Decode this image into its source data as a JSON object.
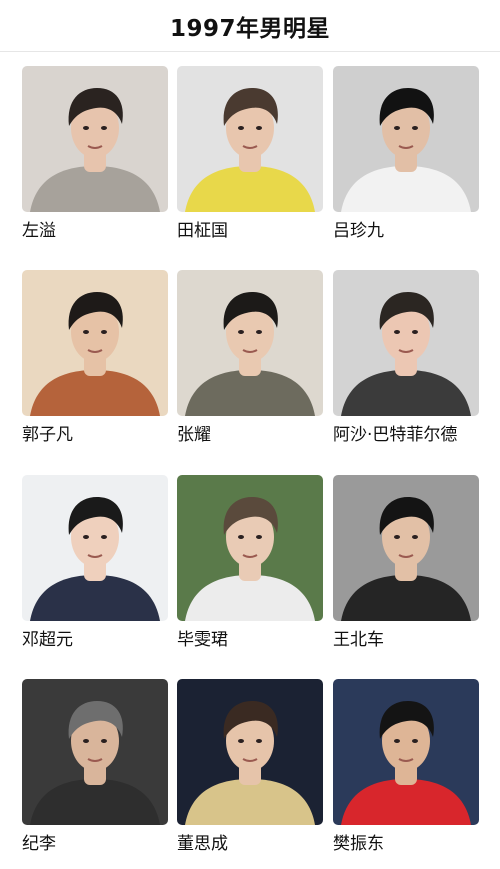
{
  "header": {
    "title": "1997年男明星"
  },
  "items": [
    {
      "name": "左溢",
      "bg": "#d9d4cf",
      "shirt": "#a7a29b",
      "hair": "#2a2320",
      "skin": "#e7c4ad"
    },
    {
      "name": "田柾国",
      "bg": "#e2e2e2",
      "shirt": "#e8d84a",
      "hair": "#4a3a30",
      "skin": "#e8c6ae"
    },
    {
      "name": "吕珍九",
      "bg": "#cfcfcf",
      "shirt": "#f2f2f2",
      "hair": "#121212",
      "skin": "#e2bfa6"
    },
    {
      "name": "郭子凡",
      "bg": "#ead8c0",
      "shirt": "#b5633b",
      "hair": "#1e1a18",
      "skin": "#e6c2a6"
    },
    {
      "name": "张耀",
      "bg": "#ddd8cf",
      "shirt": "#6d6b5e",
      "hair": "#1c1a18",
      "skin": "#e9c9b1"
    },
    {
      "name": "阿沙·巴特菲尔德",
      "bg": "#d3d3d3",
      "shirt": "#3b3b3b",
      "hair": "#2b2622",
      "skin": "#ecc7b3"
    },
    {
      "name": "邓超元",
      "bg": "#eef0f2",
      "shirt": "#2a3148",
      "hair": "#1a1a1a",
      "skin": "#efd0bd"
    },
    {
      "name": "毕雯珺",
      "bg": "#5a7a4a",
      "shirt": "#ececec",
      "hair": "#5a4a3c",
      "skin": "#e9cbb5"
    },
    {
      "name": "王北车",
      "bg": "#9a9a9a",
      "shirt": "#252525",
      "hair": "#141414",
      "skin": "#e2c0a6"
    },
    {
      "name": "纪李",
      "bg": "#3a3a3a",
      "shirt": "#2e2e2e",
      "hair": "#6e6e6e",
      "skin": "#d9b59b"
    },
    {
      "name": "董思成",
      "bg": "#1b2233",
      "shirt": "#d8c48a",
      "hair": "#3a2a22",
      "skin": "#e6c4aa"
    },
    {
      "name": "樊振东",
      "bg": "#2b3a5a",
      "shirt": "#d8262c",
      "hair": "#141414",
      "skin": "#deb596"
    }
  ]
}
